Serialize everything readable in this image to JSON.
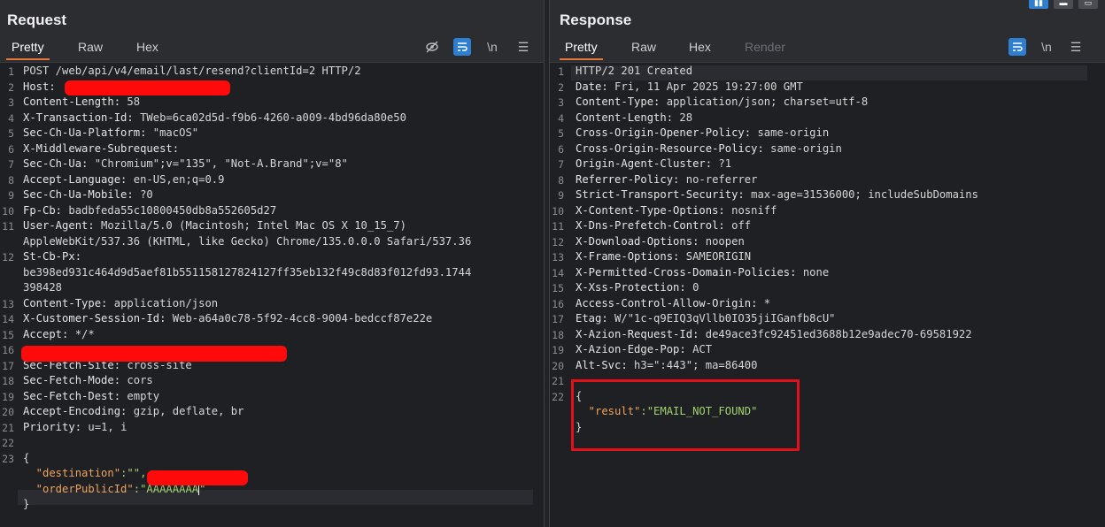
{
  "request": {
    "title": "Request",
    "tabs": [
      "Pretty",
      "Raw",
      "Hex"
    ],
    "active_tab": "Pretty",
    "toolbar": {
      "eye_off": "⊘",
      "wrap": "≡",
      "newline": "\\n",
      "menu": "☰"
    },
    "lines": [
      {
        "n": "1",
        "t": "POST /web/api/v4/email/last/resend?clientId=2 HTTP/2"
      },
      {
        "n": "2",
        "k": "Host:",
        "v": " "
      },
      {
        "n": "3",
        "k": "Content-Length:",
        "v": " 58"
      },
      {
        "n": "4",
        "k": "X-Transaction-Id:",
        "v": " TWeb=6ca02d5d-f9b6-4260-a009-4bd96da80e50"
      },
      {
        "n": "5",
        "k": "Sec-Ch-Ua-Platform:",
        "v": " \"macOS\""
      },
      {
        "n": "6",
        "k": "X-Middleware-Subrequest:",
        "v": ""
      },
      {
        "n": "7",
        "k": "Sec-Ch-Ua:",
        "v": " \"Chromium\";v=\"135\", \"Not-A.Brand\";v=\"8\""
      },
      {
        "n": "8",
        "k": "Accept-Language:",
        "v": " en-US,en;q=0.9"
      },
      {
        "n": "9",
        "k": "Sec-Ch-Ua-Mobile:",
        "v": " ?0"
      },
      {
        "n": "10",
        "k": "Fp-Cb:",
        "v": " badbfeda55c10800450db8a552605d27"
      },
      {
        "n": "11",
        "k": "User-Agent:",
        "v": " Mozilla/5.0 (Macintosh; Intel Mac OS X 10_15_7)"
      },
      {
        "n": "",
        "t": "AppleWebKit/537.36 (KHTML, like Gecko) Chrome/135.0.0.0 Safari/537.36"
      },
      {
        "n": "12",
        "k": "St-Cb-Px:",
        "v": ""
      },
      {
        "n": "",
        "t": "be398ed931c464d9d5aef81b551158127824127ff35eb132f49c8d83f012fd93.1744"
      },
      {
        "n": "",
        "t": "398428"
      },
      {
        "n": "13",
        "k": "Content-Type:",
        "v": " application/json"
      },
      {
        "n": "14",
        "k": "X-Customer-Session-Id:",
        "v": " Web-a64a0c78-5f92-4cc8-9004-bedccf87e22e"
      },
      {
        "n": "15",
        "k": "Accept:",
        "v": " */*"
      },
      {
        "n": "16",
        "t": ""
      },
      {
        "n": "17",
        "k": "Sec-Fetch-Site:",
        "v": " cross-site"
      },
      {
        "n": "18",
        "k": "Sec-Fetch-Mode:",
        "v": " cors"
      },
      {
        "n": "19",
        "k": "Sec-Fetch-Dest:",
        "v": " empty"
      },
      {
        "n": "20",
        "k": "Accept-Encoding:",
        "v": " gzip, deflate, br"
      },
      {
        "n": "21",
        "k": "Priority:",
        "v": " u=1, i"
      },
      {
        "n": "22",
        "t": ""
      },
      {
        "n": "23",
        "t": "{"
      },
      {
        "n": "",
        "jk": "  \"destination\"",
        "jv": ":\"",
        "tail": "\","
      },
      {
        "n": "",
        "jk": "  \"orderPublicId\"",
        "jv": ":\"AAAAAAAA",
        "tail": "\""
      },
      {
        "n": "",
        "t": "}"
      }
    ]
  },
  "response": {
    "title": "Response",
    "tabs": [
      "Pretty",
      "Raw",
      "Hex",
      "Render"
    ],
    "active_tab": "Pretty",
    "toolbar": {
      "wrap": "≡",
      "newline": "\\n",
      "menu": "☰"
    },
    "lines": [
      {
        "n": "1",
        "t": "HTTP/2 201 Created"
      },
      {
        "n": "2",
        "k": "Date:",
        "v": " Fri, 11 Apr 2025 19:27:00 GMT"
      },
      {
        "n": "3",
        "k": "Content-Type:",
        "v": " application/json; charset=utf-8"
      },
      {
        "n": "4",
        "k": "Content-Length:",
        "v": " 28"
      },
      {
        "n": "5",
        "k": "Cross-Origin-Opener-Policy:",
        "v": " same-origin"
      },
      {
        "n": "6",
        "k": "Cross-Origin-Resource-Policy:",
        "v": " same-origin"
      },
      {
        "n": "7",
        "k": "Origin-Agent-Cluster:",
        "v": " ?1"
      },
      {
        "n": "8",
        "k": "Referrer-Policy:",
        "v": " no-referrer"
      },
      {
        "n": "9",
        "k": "Strict-Transport-Security:",
        "v": " max-age=31536000; includeSubDomains"
      },
      {
        "n": "10",
        "k": "X-Content-Type-Options:",
        "v": " nosniff"
      },
      {
        "n": "11",
        "k": "X-Dns-Prefetch-Control:",
        "v": " off"
      },
      {
        "n": "12",
        "k": "X-Download-Options:",
        "v": " noopen"
      },
      {
        "n": "13",
        "k": "X-Frame-Options:",
        "v": " SAMEORIGIN"
      },
      {
        "n": "14",
        "k": "X-Permitted-Cross-Domain-Policies:",
        "v": " none"
      },
      {
        "n": "15",
        "k": "X-Xss-Protection:",
        "v": " 0"
      },
      {
        "n": "16",
        "k": "Access-Control-Allow-Origin:",
        "v": " *"
      },
      {
        "n": "17",
        "k": "Etag:",
        "v": " W/\"1c-q9EIQ3qVllb0IO35jiIGanfb8cU\""
      },
      {
        "n": "18",
        "k": "X-Azion-Request-Id:",
        "v": " de49ace3fc92451ed3688b12e9adec70-69581922"
      },
      {
        "n": "19",
        "k": "X-Azion-Edge-Pop:",
        "v": " ACT"
      },
      {
        "n": "20",
        "k": "Alt-Svc:",
        "v": " h3=\":443\"; ma=86400"
      },
      {
        "n": "21",
        "t": ""
      },
      {
        "n": "22",
        "t": "{"
      },
      {
        "n": "",
        "jk": "  \"result\"",
        "jv": ":\"EMAIL_NOT_FOUND\"",
        "tail": ""
      },
      {
        "n": "",
        "t": "}"
      }
    ]
  },
  "colors": {
    "accent": "#e8743b",
    "highlight": "#2f7fd1",
    "redaction": "#ff0a0a"
  }
}
